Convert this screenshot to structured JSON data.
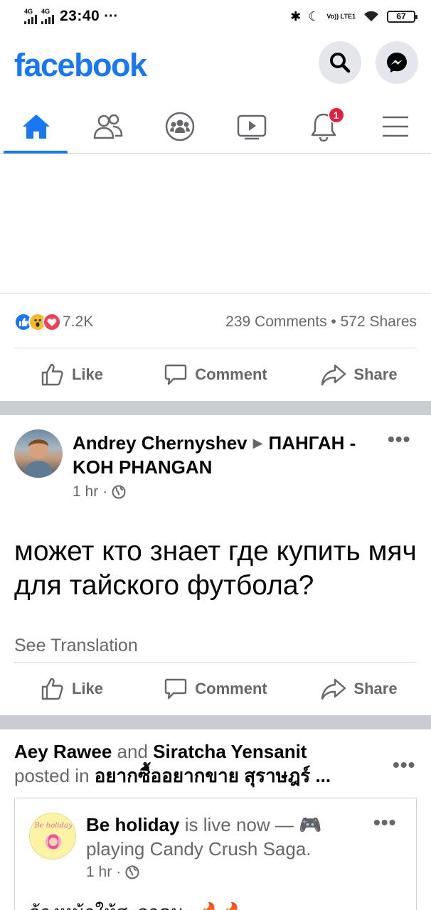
{
  "status_bar": {
    "network1": "4G",
    "network2": "4G",
    "time": "23:40",
    "more": "···",
    "volte": "Vo)) LTE1",
    "battery": "67"
  },
  "header": {
    "logo": "facebook",
    "search_icon": "search-icon",
    "messenger_icon": "messenger-icon",
    "brand_color": "#1877f2"
  },
  "tabs": [
    {
      "name": "home",
      "icon": "home-icon",
      "active": true
    },
    {
      "name": "friends",
      "icon": "friends-icon"
    },
    {
      "name": "groups",
      "icon": "groups-icon"
    },
    {
      "name": "watch",
      "icon": "watch-icon"
    },
    {
      "name": "notifications",
      "icon": "bell-icon",
      "badge": "1"
    },
    {
      "name": "menu",
      "icon": "menu-icon"
    }
  ],
  "post1": {
    "reaction_count": "7.2K",
    "comments_shares": "239 Comments • 572 Shares",
    "actions": {
      "like": "Like",
      "comment": "Comment",
      "share": "Share"
    }
  },
  "post2": {
    "author": "Andrey Chernyshev",
    "group": "ПАНГАН - KOH PHANGAN",
    "time": "1 hr",
    "dot": "·",
    "text": "может кто знает где купить мяч для тайского футбола?",
    "see_translation": "See Translation",
    "actions": {
      "like": "Like",
      "comment": "Comment",
      "share": "Share"
    }
  },
  "post3": {
    "author1": "Aey Rawee",
    "and": "and",
    "author2": "Siratcha Yensanit",
    "posted_in": "posted in",
    "group": "อยากซื้ออยากขาย สุราษฎร์ ...",
    "shared": {
      "avatar_text": "Be holiday",
      "name": "Be holiday",
      "status": "is live now — 🎮 playing Candy Crush Saga.",
      "time": "1 hr",
      "dot": "·",
      "text": "ล้างหน้าให้สะอาดนะ 🔥🔥"
    }
  }
}
